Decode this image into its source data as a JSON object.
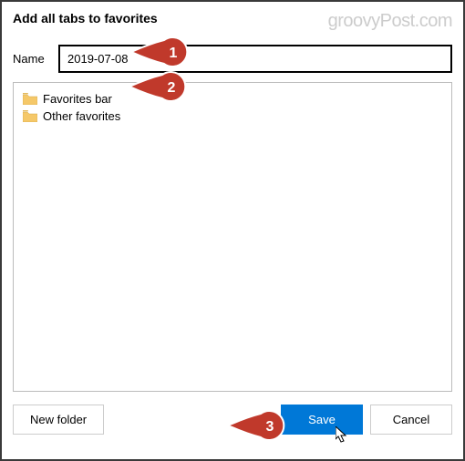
{
  "dialog": {
    "title": "Add all tabs to favorites",
    "watermark": "groovyPost.com"
  },
  "name_field": {
    "label": "Name",
    "value": "2019-07-08"
  },
  "folders": [
    {
      "label": "Favorites bar"
    },
    {
      "label": "Other favorites"
    }
  ],
  "buttons": {
    "new_folder": "New folder",
    "save": "Save",
    "cancel": "Cancel"
  },
  "annotations": {
    "step1": "1",
    "step2": "2",
    "step3": "3"
  }
}
